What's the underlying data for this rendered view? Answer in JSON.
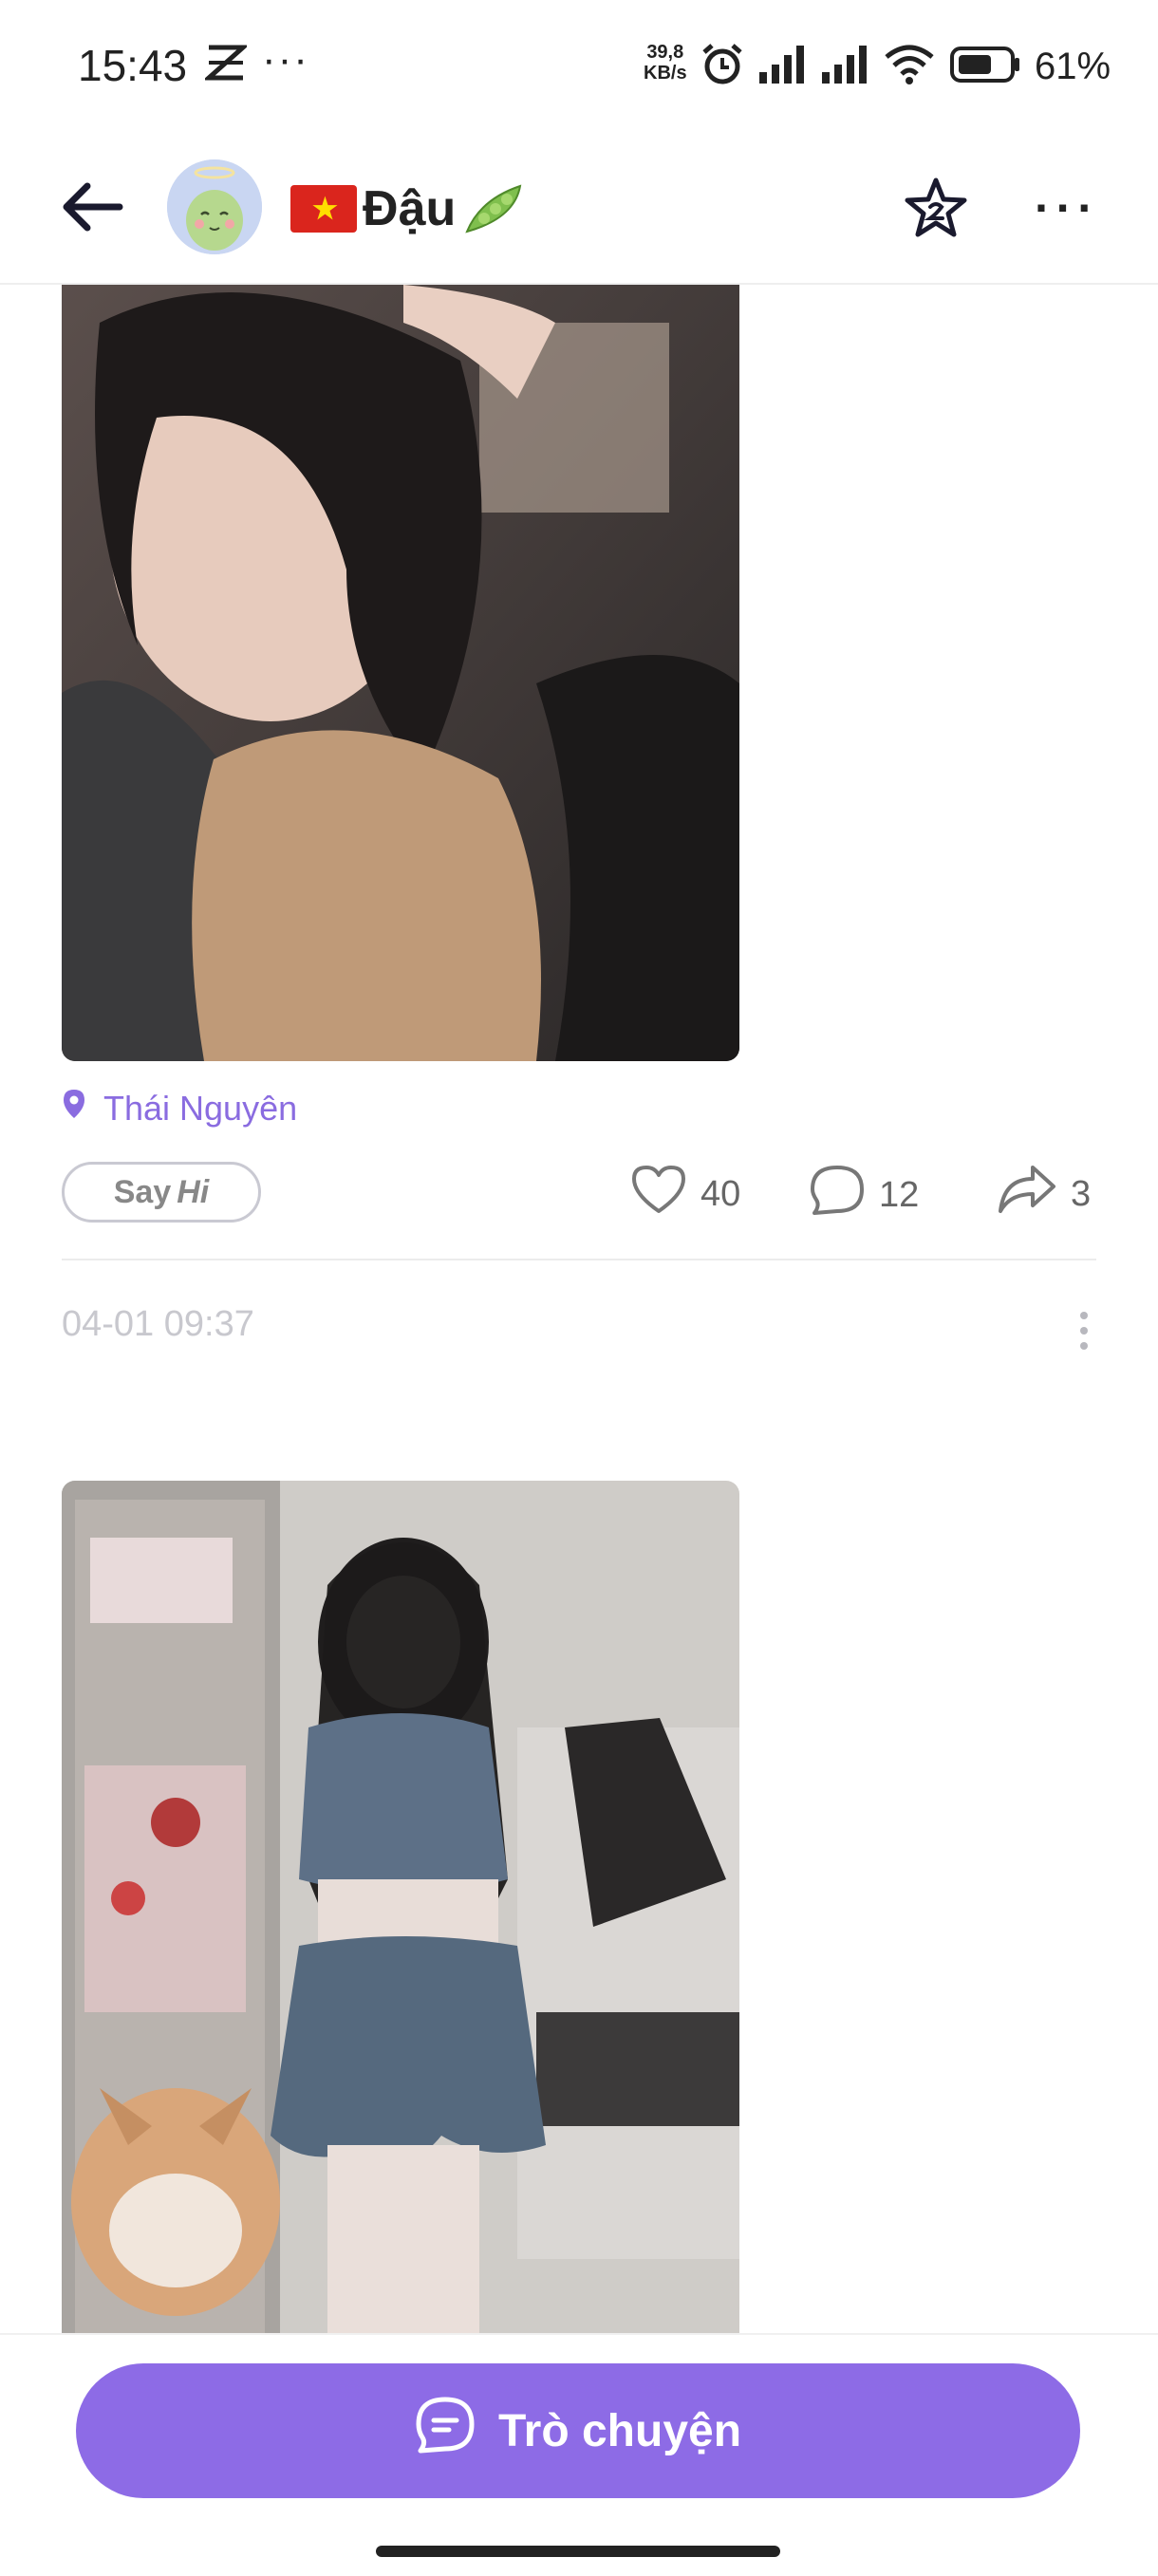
{
  "status_bar": {
    "time": "15:43",
    "net_speed_value": "39,8",
    "net_speed_unit": "KB/s",
    "battery_percent": "61%"
  },
  "header": {
    "title": "Đậu"
  },
  "posts": [
    {
      "location": "Thái Nguyên",
      "say_hi_prefix": "Say",
      "say_hi_suffix": "Hi",
      "likes": "40",
      "comments": "12",
      "shares": "3",
      "timestamp": "04-01 09:37"
    }
  ],
  "bottom": {
    "chat_label": "Trò chuyện"
  },
  "colors": {
    "accent": "#8d6be6",
    "location": "#8a6ce0"
  }
}
